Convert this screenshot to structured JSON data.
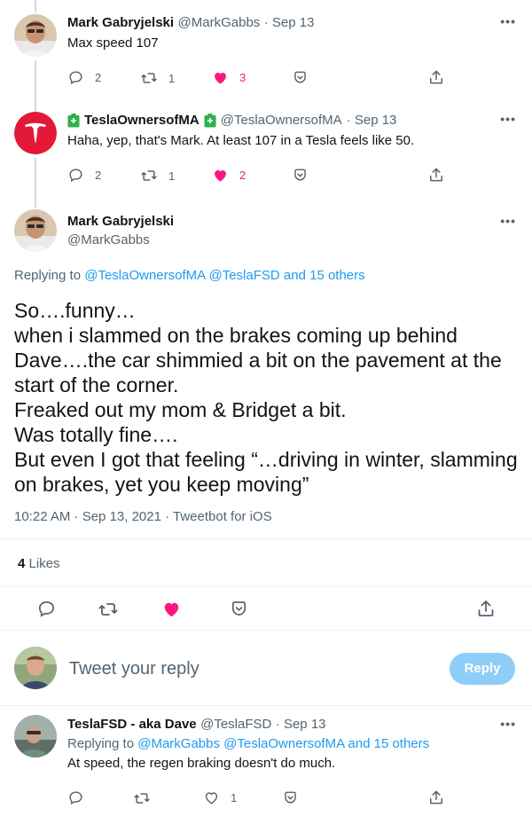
{
  "tweet1": {
    "name": "Mark Gabryjelski",
    "handle": "@MarkGabbs",
    "time": "· Sep 13",
    "text": "Max speed 107",
    "replies": "2",
    "retweets": "1",
    "likes": "3"
  },
  "tweet2": {
    "name": "TeslaOwnersofMA",
    "handle": "@TeslaOwnersofMA",
    "time": "· Sep 13",
    "text": "Haha, yep, that's Mark. At least 107 in a Tesla feels like 50.",
    "replies": "2",
    "retweets": "1",
    "likes": "2"
  },
  "main": {
    "name": "Mark Gabryjelski",
    "handle": "@MarkGabbs",
    "replying_prefix": "Replying to ",
    "replying_to": "@TeslaOwnersofMA @TeslaFSD and 15 others",
    "lines": [
      "So….funny…",
      "when i slammed on the brakes coming up behind",
      "Dave….the car shimmied a bit on the pavement at the",
      "start of the corner.",
      "Freaked out my mom & Bridget a bit.",
      "Was totally fine….",
      "But even I got that feeling “…driving in winter, slamming",
      "on brakes, yet you keep moving”"
    ],
    "meta": "10:22 AM · Sep 13, 2021 · Tweetbot for iOS",
    "likes_count": "4",
    "likes_label": " Likes"
  },
  "composer": {
    "placeholder": "Tweet your reply",
    "button": "Reply"
  },
  "tweet3": {
    "name": "TeslaFSD - aka Dave",
    "handle": "@TeslaFSD",
    "time": "· Sep 13",
    "replying_prefix": "Replying to ",
    "replying_to": "@MarkGabbs @TeslaOwnersofMA and 15 others",
    "text": "At speed, the regen braking doesn't do much.",
    "likes": "1"
  },
  "icons": {
    "more": "more-dots-icon",
    "reply": "reply-icon",
    "retweet": "retweet-icon",
    "like": "heart-icon",
    "save": "save-icon",
    "share": "share-icon",
    "verified_battery": "battery-badge-icon"
  },
  "colors": {
    "accent": "#1d9bf0",
    "like": "#f91880",
    "muted": "#536471",
    "tesla_red": "#e31937",
    "battery_green": "#2db24a"
  },
  "more_label": "•••"
}
